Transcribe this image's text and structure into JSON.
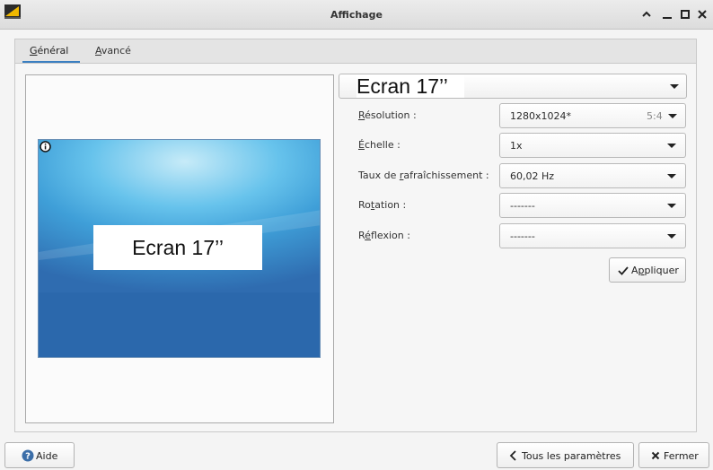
{
  "window": {
    "title": "Affichage"
  },
  "tabs": [
    {
      "label_first": "G",
      "label_rest": "énéral"
    },
    {
      "label_first": "A",
      "label_rest": "vancé"
    }
  ],
  "screen_selector": {
    "value": "Ecran 17’’"
  },
  "preview": {
    "monitor_label": "Ecran 17’’"
  },
  "form": {
    "resolution": {
      "label_first": "R",
      "label_rest": "ésolution :",
      "value": "1280x1024*",
      "ratio": "5:4"
    },
    "scale": {
      "label_first": "É",
      "label_rest": "chelle :",
      "value": "1x"
    },
    "refresh": {
      "label_pre": "Taux de ",
      "label_ul": "r",
      "label_post": "afraîchissement :",
      "value": "60,02 Hz"
    },
    "rotation": {
      "label_pre": "Ro",
      "label_ul": "t",
      "label_post": "ation :",
      "value": "-------"
    },
    "reflection": {
      "label_pre": "R",
      "label_ul": "é",
      "label_post": "flexion :",
      "value": "-------"
    },
    "apply": {
      "label_pre": "A",
      "label_ul": "p",
      "label_post": "pliquer"
    }
  },
  "footer": {
    "help": "Aide",
    "all_settings": "Tous les paramètres",
    "close": "Fermer"
  },
  "icons": {
    "app": "display-settings-icon",
    "info": "info-icon",
    "help": "help-icon",
    "check": "check-icon",
    "back": "chevron-left-icon",
    "close": "close-icon"
  },
  "colors": {
    "accent": "#3a7fc1"
  }
}
